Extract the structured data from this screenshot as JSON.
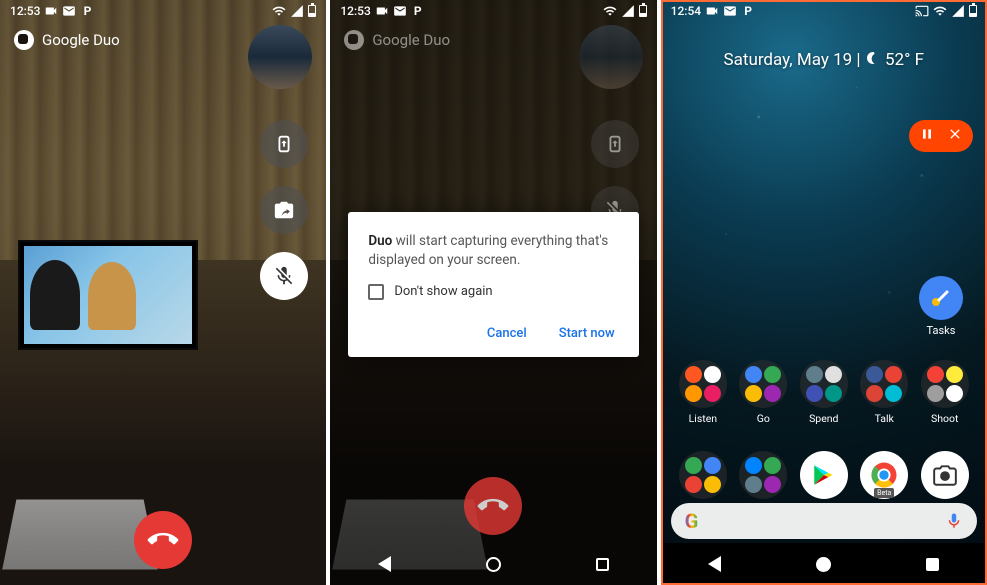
{
  "panel1": {
    "statusbar": {
      "time": "12:53"
    },
    "app_title": "Google Duo",
    "buttons": {
      "screen_share": "screen-share",
      "flip_camera": "flip-camera",
      "mute_mic": "mute-microphone",
      "end_call": "end-call"
    }
  },
  "panel2": {
    "statusbar": {
      "time": "12:53"
    },
    "app_title": "Google Duo",
    "dialog": {
      "bold": "Duo",
      "text": " will start capturing everything that's displayed on your screen.",
      "checkbox_label": "Don't show again",
      "cancel": "Cancel",
      "confirm": "Start now"
    }
  },
  "panel3": {
    "statusbar": {
      "time": "12:54"
    },
    "date": "Saturday, May 19",
    "divider": " | ",
    "temp": "52° F",
    "recording": {
      "pause": "pause",
      "close": "close"
    },
    "tasks": {
      "label": "Tasks"
    },
    "folders": [
      {
        "label": "Listen",
        "colors": [
          "#ff5722",
          "#ffffff",
          "#ff9800",
          "#e91e63"
        ]
      },
      {
        "label": "Go",
        "colors": [
          "#4285f4",
          "#34a853",
          "#fbbc05",
          "#9c27b0"
        ]
      },
      {
        "label": "Spend",
        "colors": [
          "#607d8b",
          "#e0e0e0",
          "#3f51b5",
          "#009688"
        ]
      },
      {
        "label": "Talk",
        "colors": [
          "#3b5998",
          "#ea4335",
          "#db4437",
          "#00bcd4"
        ]
      },
      {
        "label": "Shoot",
        "colors": [
          "#f44336",
          "#ffeb3b",
          "#9e9e9e",
          "#ffffff"
        ]
      }
    ],
    "dock_folders": [
      {
        "colors": [
          "#34a853",
          "#4285f4",
          "#ea4335",
          "#fbbc05"
        ]
      },
      {
        "colors": [
          "#0084ff",
          "#34a853",
          "#607d8b",
          "#9c27b0"
        ]
      }
    ],
    "dock_apps": [
      "play-store",
      "chrome",
      "camera"
    ],
    "search_letter": "G"
  }
}
